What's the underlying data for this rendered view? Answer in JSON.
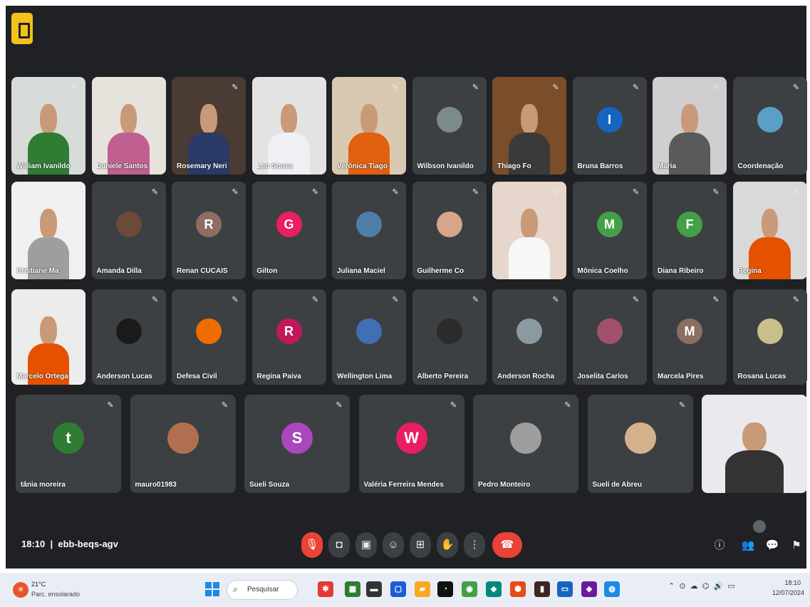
{
  "meeting": {
    "time": "18:10",
    "code": "ebb-beqs-agv"
  },
  "row1": [
    {
      "name": "William Ivanildo",
      "kind": "video",
      "bg": "#d8dcd8",
      "shirt": "#2e7d32"
    },
    {
      "name": "Daniele Santos",
      "kind": "video",
      "bg": "#e6e2dc",
      "shirt": "#c06090"
    },
    {
      "name": "Rosemary Neri",
      "kind": "video",
      "bg": "#4a3c34",
      "shirt": "#2a3a66"
    },
    {
      "name": "Leo Sousa",
      "kind": "video",
      "bg": "#e3e3e3",
      "shirt": "#f0f0f4"
    },
    {
      "name": "Verônica Tiago",
      "kind": "video",
      "bg": "#d9c9b0",
      "shirt": "#e06010"
    },
    {
      "name": "Wilbson Ivanildo",
      "kind": "avatar-photo",
      "avatar": "#7b8a8b"
    },
    {
      "name": "Thiago Fo",
      "kind": "video",
      "bg": "#7a4e2a",
      "shirt": "#3a3a3a"
    },
    {
      "name": "Bruna Barros",
      "kind": "letter",
      "letter": "I",
      "avatar": "#1565c0"
    },
    {
      "name": "Maria",
      "kind": "video",
      "bg": "#cfcfcf",
      "shirt": "#5a5a5a"
    },
    {
      "name": "Coordenação",
      "kind": "avatar-photo",
      "avatar": "#5b9fc7"
    }
  ],
  "row2": [
    {
      "name": "Cristiane Ma",
      "kind": "video",
      "bg": "#f0f0f0",
      "shirt": "#9e9e9e"
    },
    {
      "name": "Amanda Dilla",
      "kind": "avatar-photo",
      "avatar": "#6b4a3a"
    },
    {
      "name": "Renan CUCAIS",
      "kind": "letter",
      "letter": "R",
      "avatar": "#8d6e63"
    },
    {
      "name": "Gilton",
      "kind": "letter",
      "letter": "G",
      "avatar": "#e91e63"
    },
    {
      "name": "Juliana Maciel",
      "kind": "avatar-photo",
      "avatar": "#4f7ea8"
    },
    {
      "name": "Guilherme Co",
      "kind": "avatar-photo",
      "avatar": "#d7a58a"
    },
    {
      "name": "",
      "kind": "video",
      "bg": "#e6d6cc",
      "shirt": "#f7f7f7"
    },
    {
      "name": "Mônica Coelho",
      "kind": "letter",
      "letter": "M",
      "avatar": "#43a047"
    },
    {
      "name": "Diana Ribeiro",
      "kind": "letter",
      "letter": "F",
      "avatar": "#43a047"
    },
    {
      "name": "Regina",
      "kind": "video",
      "bg": "#d9d9d9",
      "shirt": "#e65100"
    }
  ],
  "row3": [
    {
      "name": "Marcelo Ortega",
      "kind": "video",
      "bg": "#ececec",
      "shirt": "#e65100"
    },
    {
      "name": "Anderson Lucas",
      "kind": "avatar-photo",
      "avatar": "#1a1a1a"
    },
    {
      "name": "Defesa Civil",
      "kind": "avatar-photo",
      "avatar": "#ef6c00"
    },
    {
      "name": "Regina Paiva",
      "kind": "letter",
      "letter": "R",
      "avatar": "#c2185b"
    },
    {
      "name": "Wellington Lima",
      "kind": "avatar-photo",
      "avatar": "#3f6fb5"
    },
    {
      "name": "Alberto Pereira",
      "kind": "avatar-photo",
      "avatar": "#2b2b2b"
    },
    {
      "name": "Anderson Rocha",
      "kind": "avatar-photo",
      "avatar": "#8a9aa0"
    },
    {
      "name": "Joselita Carlos",
      "kind": "avatar-photo",
      "avatar": "#a0506a"
    },
    {
      "name": "Marcela Pires",
      "kind": "letter",
      "letter": "M",
      "avatar": "#8d6e63"
    },
    {
      "name": "Rosana Lucas",
      "kind": "avatar-photo",
      "avatar": "#c7c08a"
    }
  ],
  "row4": [
    {
      "name": "tânia moreira",
      "kind": "letter",
      "letter": "t",
      "avatar": "#2e7d32"
    },
    {
      "name": "mauro01983",
      "kind": "avatar-photo",
      "avatar": "#b07050"
    },
    {
      "name": "Sueli Souza",
      "kind": "letter",
      "letter": "S",
      "avatar": "#ab47bc"
    },
    {
      "name": "Valéria Ferreira Mendes",
      "kind": "letter",
      "letter": "W",
      "avatar": "#e91e63"
    },
    {
      "name": "Pedro Monteiro",
      "kind": "avatar-photo",
      "avatar": "#9e9e9e"
    },
    {
      "name": "Sueli de Abreu",
      "kind": "avatar-photo",
      "avatar": "#d6b28c"
    },
    {
      "name": "",
      "kind": "video",
      "bg": "#e9e9ee",
      "shirt": "#333"
    }
  ],
  "controls": {
    "mic_icon": "mic-off-icon",
    "end_icon": "phone-hangup-icon"
  },
  "taskbar": {
    "weather_temp": "21°C",
    "weather_desc": "Parc. ensolarado",
    "search_text": "Pesquisar",
    "date": "18:10",
    "day": "12/07/2024"
  },
  "colors": {
    "meet_bg": "#202124",
    "tile_bg": "#3c4043",
    "danger": "#ea4335",
    "accent": "#f2c11b"
  }
}
